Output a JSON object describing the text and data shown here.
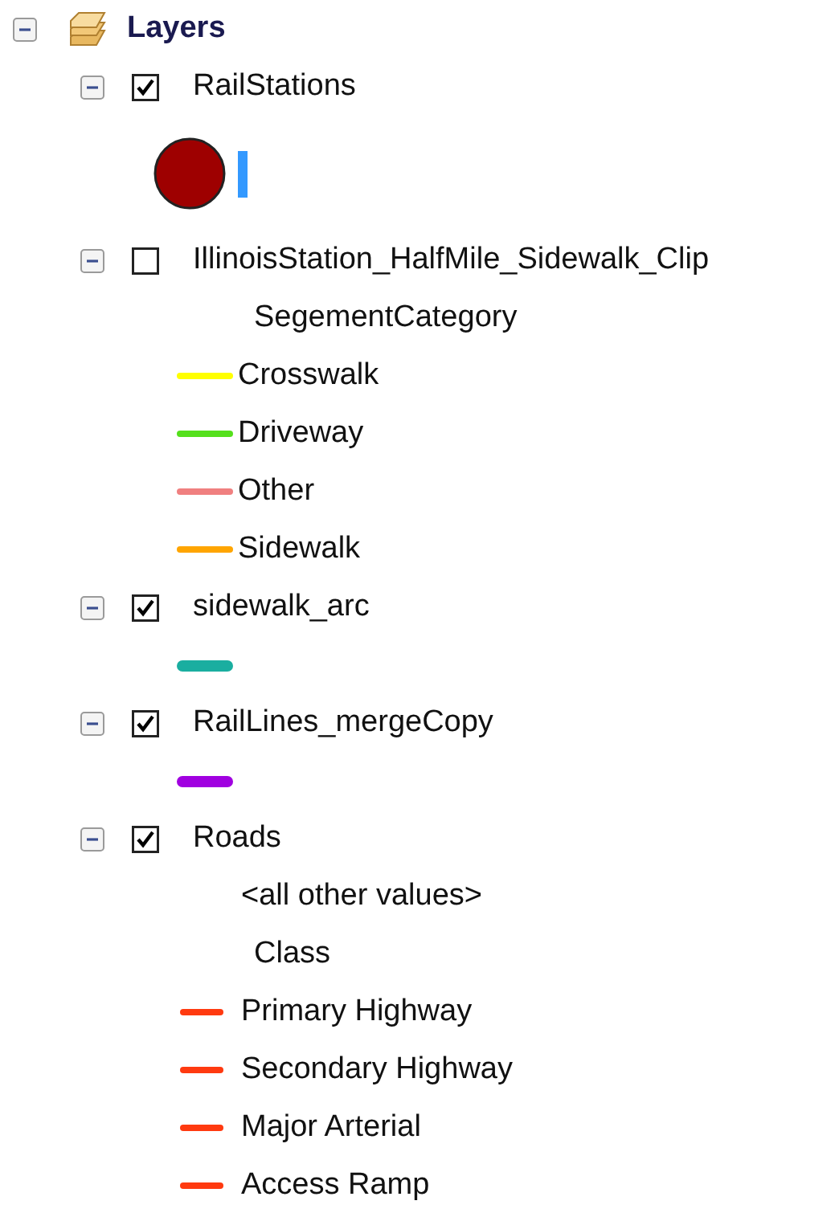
{
  "root": {
    "title": "Layers",
    "expanded": true
  },
  "layers": [
    {
      "name": "RailStations",
      "checked": true,
      "expanded": true,
      "legend": [
        {
          "kind": "point",
          "color": "#9e0000"
        }
      ]
    },
    {
      "name": "IllinoisStation_HalfMile_Sidewalk_Clip",
      "checked": false,
      "expanded": true,
      "legend": [
        {
          "kind": "heading",
          "label": "SegementCategory"
        },
        {
          "kind": "line",
          "label": "Crosswalk",
          "color": "#ffff00"
        },
        {
          "kind": "line",
          "label": "Driveway",
          "color": "#55e01c"
        },
        {
          "kind": "line",
          "label": "Other",
          "color": "#f08080"
        },
        {
          "kind": "line",
          "label": "Sidewalk",
          "color": "#ffa500"
        }
      ]
    },
    {
      "name": "sidewalk_arc",
      "checked": true,
      "expanded": true,
      "legend": [
        {
          "kind": "bar",
          "color": "#1aaea0"
        }
      ]
    },
    {
      "name": "RailLines_mergeCopy",
      "checked": true,
      "expanded": true,
      "legend": [
        {
          "kind": "bar",
          "color": "#a000e0"
        }
      ]
    },
    {
      "name": "Roads",
      "checked": true,
      "expanded": true,
      "legend": [
        {
          "kind": "note",
          "label": "<all other values>"
        },
        {
          "kind": "heading",
          "label": "Class"
        },
        {
          "kind": "short",
          "label": "Primary Highway",
          "color": "#ff3a10"
        },
        {
          "kind": "short",
          "label": "Secondary Highway",
          "color": "#ff3a10"
        },
        {
          "kind": "short",
          "label": "Major Arterial",
          "color": "#ff3a10"
        },
        {
          "kind": "short",
          "label": "Access Ramp",
          "color": "#ff3a10"
        }
      ]
    }
  ]
}
